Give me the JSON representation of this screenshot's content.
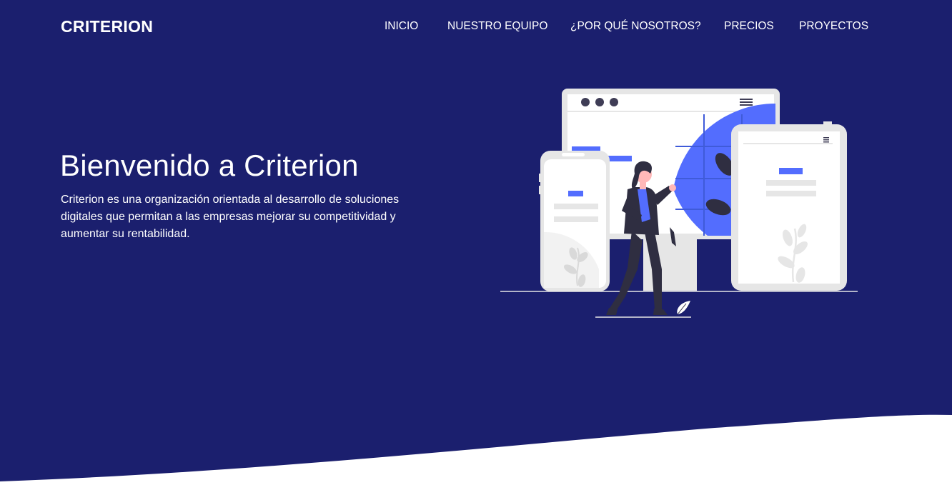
{
  "navbar": {
    "logo": "CRITERION",
    "links": [
      {
        "label": "INICIO"
      },
      {
        "label": "NUESTRO EQUIPO"
      },
      {
        "label": "¿POR QUÉ NOSOTROS?"
      },
      {
        "label": "PRECIOS"
      },
      {
        "label": "PROYECTOS"
      }
    ]
  },
  "hero": {
    "title": "Bienvenido a Criterion",
    "description": "Criterion es una organización orientada al desarrollo de soluciones digitales que permitan a las empresas mejorar su competitividad y aumentar su rentabilidad."
  },
  "colors": {
    "background": "#1b1f6e",
    "accent": "#536dfe",
    "text": "#ffffff",
    "wave": "#ffffff"
  }
}
